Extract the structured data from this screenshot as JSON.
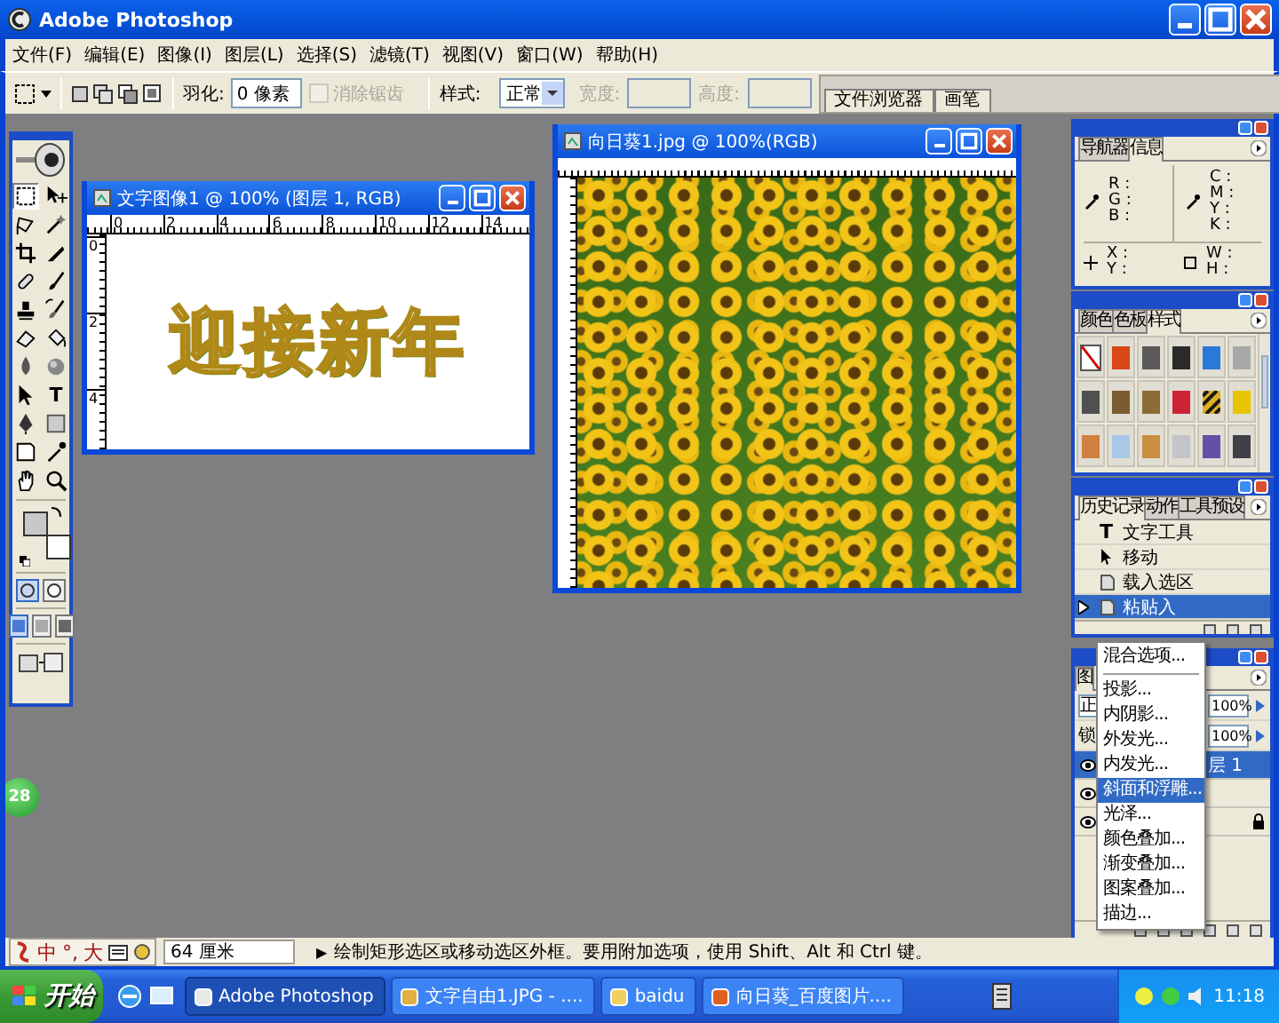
{
  "window": {
    "title": "Adobe Photoshop"
  },
  "menu": [
    "文件(F)",
    "编辑(E)",
    "图像(I)",
    "图层(L)",
    "选择(S)",
    "滤镜(T)",
    "视图(V)",
    "窗口(W)",
    "帮助(H)"
  ],
  "options_bar": {
    "feather_label": "羽化:",
    "feather_value": "0 像素",
    "antialias": {
      "label": "消除锯齿",
      "checked": false,
      "disabled": true
    },
    "style_label": "样式:",
    "style_value": "正常",
    "width_label": "宽度:",
    "height_label": "高度:",
    "fields_disabled": true,
    "well_tabs": [
      "文件浏览器",
      "画笔"
    ]
  },
  "toolbox": {
    "tools": [
      {
        "kind": "marquee",
        "selected": true
      },
      {
        "kind": "move",
        "selected": false
      },
      {
        "kind": "lasso",
        "selected": false
      },
      {
        "kind": "wand",
        "selected": false
      },
      {
        "kind": "crop",
        "selected": false
      },
      {
        "kind": "slice",
        "selected": false
      },
      {
        "kind": "heal",
        "selected": false
      },
      {
        "kind": "brush",
        "selected": false
      },
      {
        "kind": "stamp",
        "selected": false
      },
      {
        "kind": "historybrush",
        "selected": false
      },
      {
        "kind": "eraser",
        "selected": false
      },
      {
        "kind": "bucket",
        "selected": false
      },
      {
        "kind": "blur",
        "selected": false
      },
      {
        "kind": "dodge",
        "selected": false
      },
      {
        "kind": "pathselect",
        "selected": false
      },
      {
        "kind": "type",
        "glyph": "T",
        "selected": false
      },
      {
        "kind": "pen",
        "selected": false
      },
      {
        "kind": "shape",
        "selected": false
      },
      {
        "kind": "notes",
        "selected": false
      },
      {
        "kind": "eyedropper",
        "selected": false
      },
      {
        "kind": "hand",
        "selected": false
      },
      {
        "kind": "zoom",
        "selected": false
      }
    ],
    "colors": [
      {
        "kind": "foreground",
        "color": "#c8c8c8"
      },
      {
        "kind": "background",
        "color": "#ffffff"
      }
    ],
    "mask_modes": [
      {
        "selected": true
      },
      {
        "selected": false
      }
    ],
    "screen_modes": [
      {
        "selected": true
      },
      {
        "selected": false
      },
      {
        "selected": false
      }
    ]
  },
  "documents": [
    {
      "title": "文字图像1 @ 100% (图层 1, RGB)",
      "ruler_h": [
        "0",
        "2",
        "4",
        "6",
        "8",
        "10",
        "12",
        "14"
      ],
      "ruler_v": [
        "0",
        "2",
        "4"
      ],
      "canvas_text": "迎接新年",
      "kind": "text"
    },
    {
      "title": "向日葵1.jpg @ 100%(RGB)",
      "kind": "photo"
    }
  ],
  "info_panel": {
    "tabs": [
      {
        "label": "导航器",
        "selected": false
      },
      {
        "label": "信息",
        "selected": true
      }
    ],
    "rgb": [
      "R :",
      "G :",
      "B :"
    ],
    "cmyk": [
      "C :",
      "M :",
      "Y :",
      "K :"
    ],
    "xy": [
      "X :",
      "Y :"
    ],
    "wh": [
      "W :",
      "H :"
    ]
  },
  "styles_panel": {
    "tabs": [
      {
        "label": "颜色",
        "selected": false
      },
      {
        "label": "色板",
        "selected": false
      },
      {
        "label": "样式",
        "selected": true
      }
    ],
    "swatches": [
      {
        "kind": "none",
        "color": "#ffffff"
      },
      {
        "kind": "solid",
        "color": "#d84818"
      },
      {
        "kind": "solid",
        "color": "#5a5a5a"
      },
      {
        "kind": "solid",
        "color": "#2a2a2a"
      },
      {
        "kind": "solid",
        "color": "#2a78d8"
      },
      {
        "kind": "solid",
        "color": "#a8a8a8"
      },
      {
        "kind": "solid",
        "color": "#505050"
      },
      {
        "kind": "solid",
        "color": "#7a5c30"
      },
      {
        "kind": "solid",
        "color": "#8c6c34"
      },
      {
        "kind": "solid",
        "color": "#cc2434"
      },
      {
        "kind": "pattern",
        "color": "#e0b020"
      },
      {
        "kind": "solid",
        "color": "#e8c400"
      },
      {
        "kind": "solid",
        "color": "#d08040"
      },
      {
        "kind": "solid",
        "color": "#a8c8e8"
      },
      {
        "kind": "solid",
        "color": "#c89040"
      },
      {
        "kind": "solid",
        "color": "#c4c4cc"
      },
      {
        "kind": "solid",
        "color": "#6450a4"
      },
      {
        "kind": "solid",
        "color": "#404048"
      }
    ]
  },
  "history_panel": {
    "tabs": [
      {
        "label": "历史记录",
        "selected": true
      },
      {
        "label": "动作",
        "selected": false
      },
      {
        "label": "工具预设",
        "selected": false
      }
    ],
    "items": [
      {
        "label": "文字工具",
        "kind": "type",
        "glyph": "T",
        "selected": false
      },
      {
        "label": "移动",
        "kind": "move",
        "selected": false
      },
      {
        "label": "载入选区",
        "kind": "doc",
        "selected": false
      },
      {
        "label": "粘贴入",
        "kind": "doc",
        "selected": true
      }
    ]
  },
  "layers_panel": {
    "tab": "图",
    "mode": "正",
    "lock_label": "锁",
    "opacity": "100%",
    "fill": "100%",
    "layers": [
      {
        "name": "层 1",
        "selected": true,
        "visible": true,
        "locked": false
      },
      {
        "selected": false,
        "visible": true,
        "locked": false
      },
      {
        "selected": false,
        "visible": true,
        "locked": true
      }
    ]
  },
  "style_menu": {
    "groups": [
      {
        "items": [
          {
            "label": "混合选项...",
            "selected": false
          }
        ]
      },
      {
        "items": [
          {
            "label": "投影...",
            "selected": false
          },
          {
            "label": "内阴影...",
            "selected": false
          },
          {
            "label": "外发光...",
            "selected": false
          },
          {
            "label": "内发光...",
            "selected": false
          },
          {
            "label": "斜面和浮雕...",
            "selected": true
          },
          {
            "label": "光泽...",
            "selected": false
          },
          {
            "label": "颜色叠加...",
            "selected": false
          },
          {
            "label": "渐变叠加...",
            "selected": false
          },
          {
            "label": "图案叠加...",
            "selected": false
          },
          {
            "label": "描边...",
            "selected": false
          }
        ]
      }
    ]
  },
  "side_badge": "28",
  "status_bar": {
    "ime": [
      "中",
      "°,",
      "大"
    ],
    "zoom": "64 厘米",
    "arrow": "▶",
    "message": "绘制矩形选区或移动选区外框。要用附加选项，使用 Shift、Alt 和 Ctrl 键。"
  },
  "taskbar": {
    "start": "开始",
    "items": [
      {
        "label": "Adobe Photoshop",
        "selected": true
      },
      {
        "label": "文字自由1.JPG - ....",
        "selected": false
      },
      {
        "label": "baidu",
        "selected": false
      },
      {
        "label": "向日葵_百度图片....",
        "selected": false
      }
    ],
    "clock": "11:18"
  }
}
